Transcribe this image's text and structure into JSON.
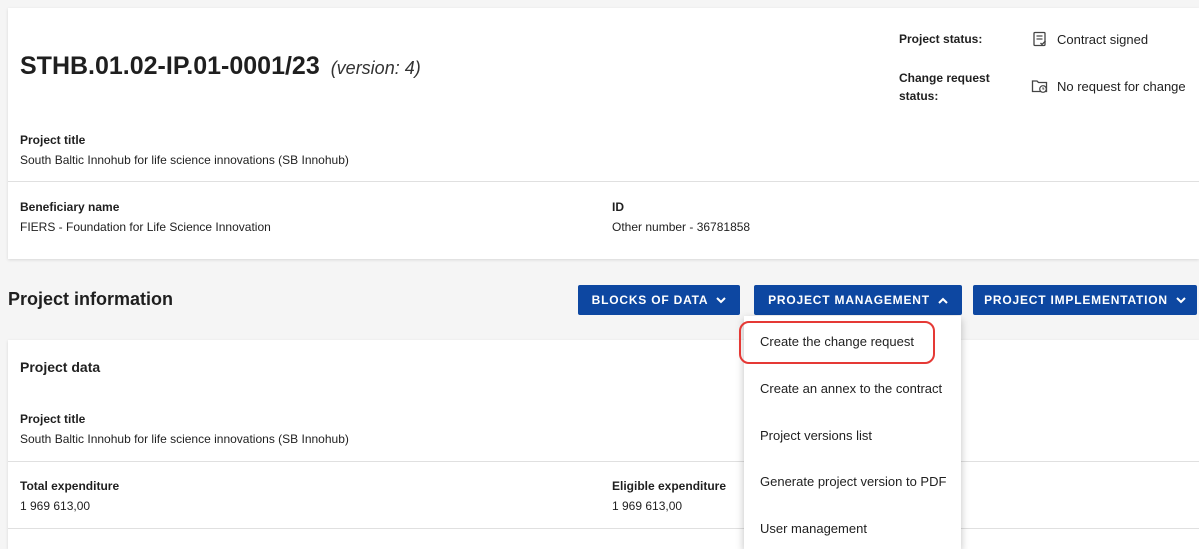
{
  "header": {
    "project_id": "STHB.01.02-IP.01-0001/23",
    "version": "(version: 4)",
    "project_status_label": "Project status:",
    "project_status_value": "Contract signed",
    "change_request_label_line1": "Change request",
    "change_request_label_line2": "status:",
    "change_request_value": "No request for change",
    "project_title_label": "Project title",
    "project_title_value": "South Baltic Innohub for life science innovations (SB Innohub)",
    "beneficiary_label": "Beneficiary name",
    "beneficiary_value": "FIERS - Foundation for Life Science Innovation",
    "id_label": "ID",
    "id_value": "Other number - 36781858"
  },
  "section": {
    "title": "Project information",
    "buttons": {
      "blocks_of_data": "BLOCKS OF DATA",
      "project_management": "PROJECT MANAGEMENT",
      "project_implementation": "PROJECT IMPLEMENTATION"
    }
  },
  "project_data": {
    "heading": "Project data",
    "project_title_label": "Project title",
    "project_title_value": "South Baltic Innohub for life science innovations (SB Innohub)",
    "total_expenditure_label": "Total expenditure",
    "total_expenditure_value": "1 969 613,00",
    "eligible_expenditure_label": "Eligible expenditure",
    "eligible_expenditure_value": "1 969 613,00"
  },
  "menu": {
    "items": [
      "Create the change request",
      "Create an annex to the contract",
      "Project versions list",
      "Generate project version to PDF",
      "User management"
    ]
  },
  "colors": {
    "button_bg": "#0d47a1",
    "highlight": "#e53935"
  },
  "icons": {
    "status": "document-check-icon",
    "change_request": "folder-clock-icon",
    "chevron_down": "chevron-down-icon",
    "chevron_up": "chevron-up-icon"
  }
}
